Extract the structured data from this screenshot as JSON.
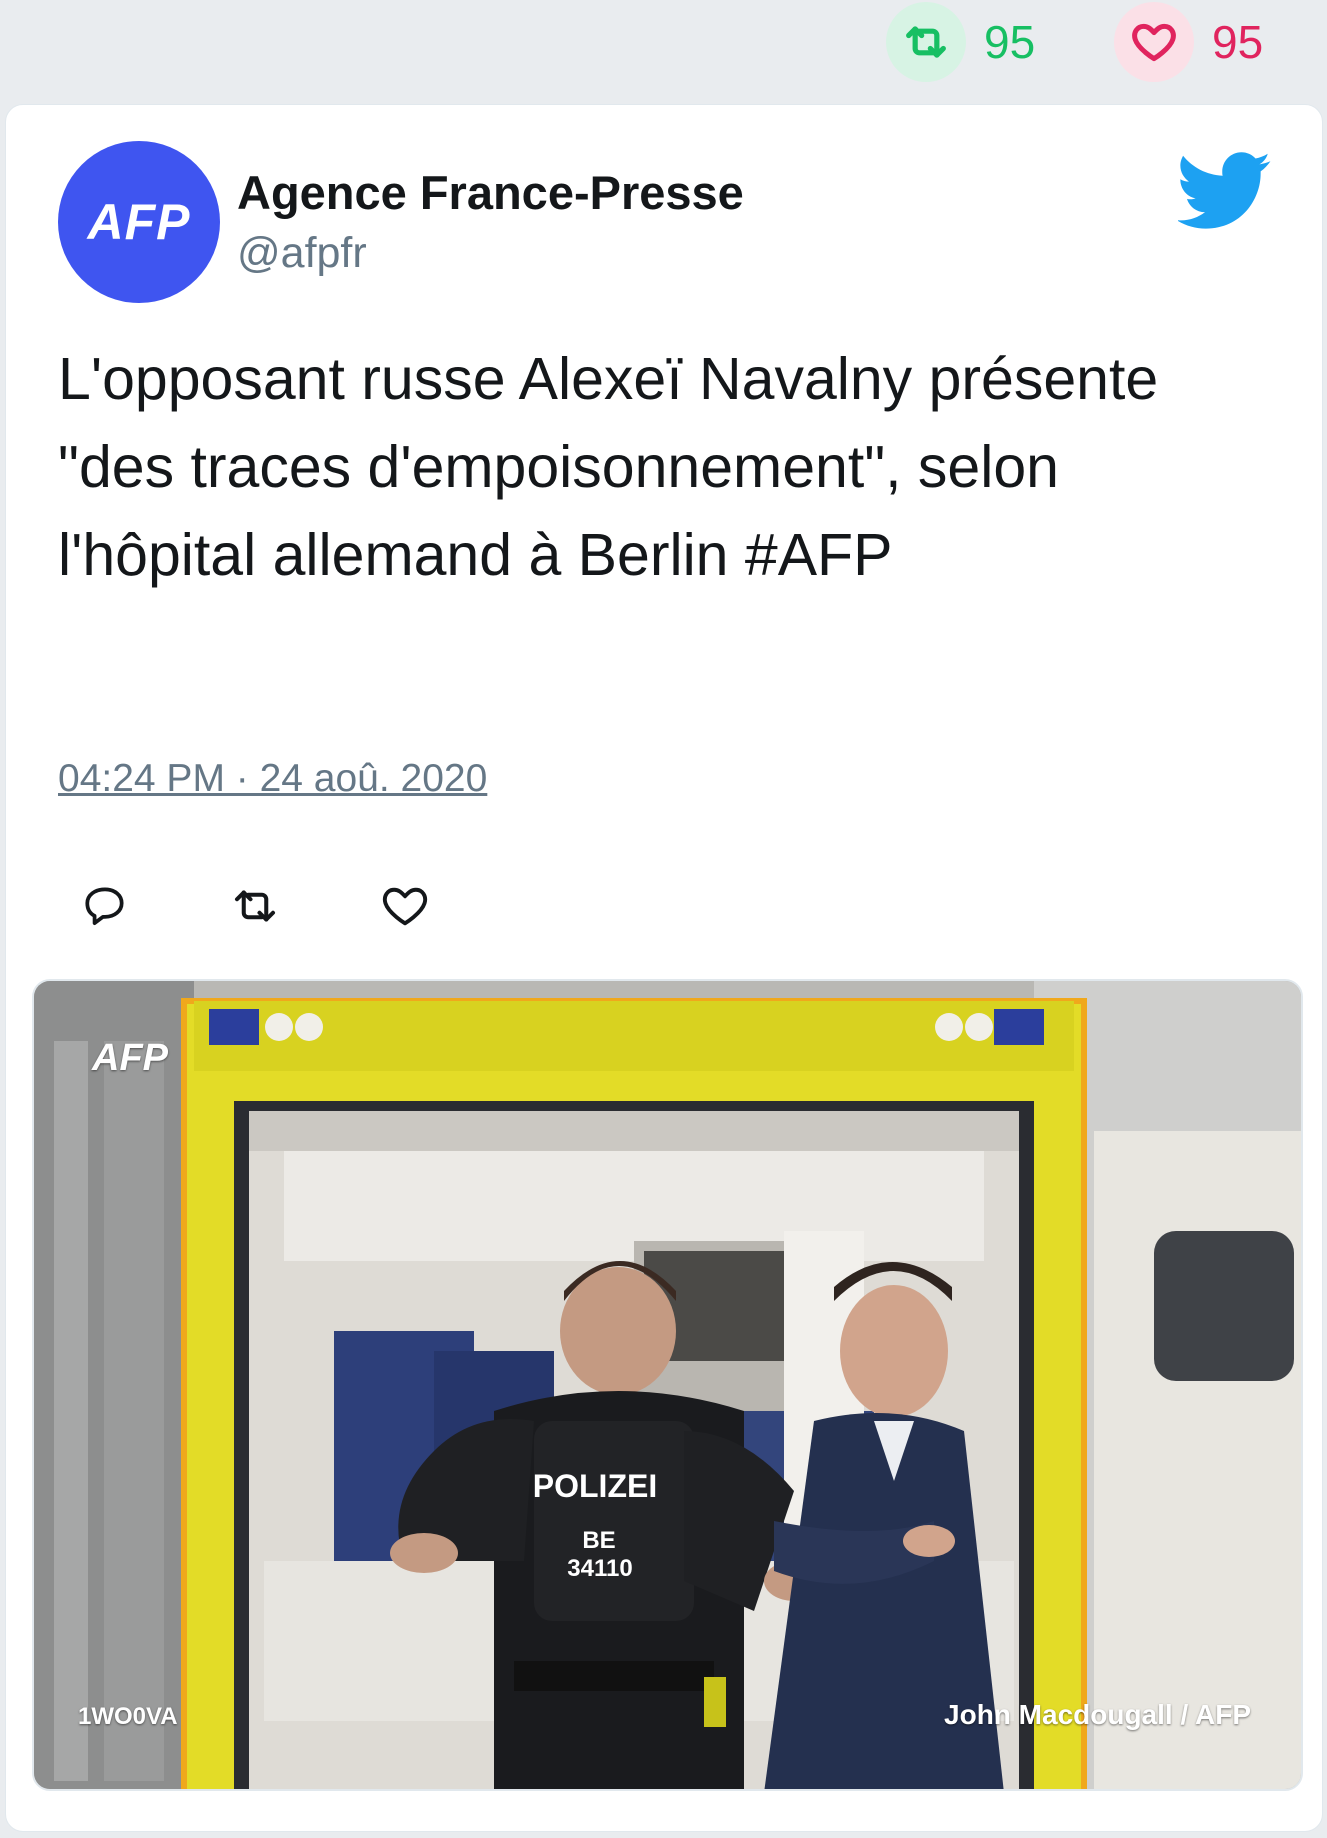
{
  "stats": {
    "retweets": "95",
    "likes": "95",
    "colors": {
      "retweet": "#17bf63",
      "like": "#e0245e"
    }
  },
  "tweet": {
    "author_name": "Agence France-Presse",
    "handle": "@afpfr",
    "avatar_text": "AFP",
    "avatar_color": "#3f55f0",
    "text": "L'opposant russe Alexeï Navalny présente \"des traces d'empoisonnement\", selon l'hôpital allemand à Berlin #AFP",
    "timestamp": "04:24 PM · 24 aoû. 2020"
  },
  "actions": {
    "icons": [
      "reply-icon",
      "retweet-icon",
      "like-icon"
    ]
  },
  "media": {
    "watermark": "AFP",
    "code": "1WO0VA",
    "credit": "John Macdougall / AFP",
    "vest_label": "POLIZEI",
    "vest_code_line1": "BE",
    "vest_code_line2": "34110"
  },
  "brand": {
    "twitter_blue": "#1da1f2"
  }
}
